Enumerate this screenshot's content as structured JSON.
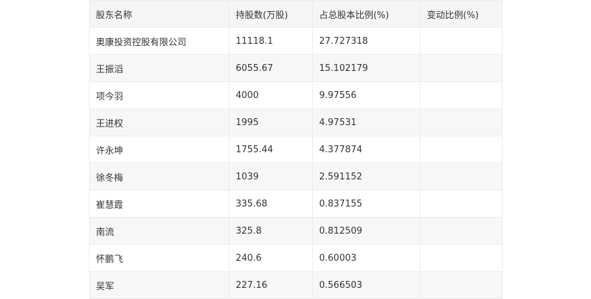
{
  "table": {
    "headers": [
      "股东名称",
      "持股数(万股)",
      "占总股本比例(%)",
      "变动比例(%)"
    ],
    "rows": [
      [
        "奥康投资控股有限公司",
        "11118.1",
        "27.727318",
        ""
      ],
      [
        "王振滔",
        "6055.67",
        "15.102179",
        ""
      ],
      [
        "项今羽",
        "4000",
        "9.97556",
        ""
      ],
      [
        "王进权",
        "1995",
        "4.97531",
        ""
      ],
      [
        "许永坤",
        "1755.44",
        "4.377874",
        ""
      ],
      [
        "徐冬梅",
        "1039",
        "2.591152",
        ""
      ],
      [
        "崔慧霞",
        "335.68",
        "0.837155",
        ""
      ],
      [
        "南流",
        "325.8",
        "0.812509",
        ""
      ],
      [
        "怀鹏飞",
        "240.6",
        "0.60003",
        ""
      ],
      [
        "吴军",
        "227.16",
        "0.566503",
        ""
      ]
    ]
  }
}
